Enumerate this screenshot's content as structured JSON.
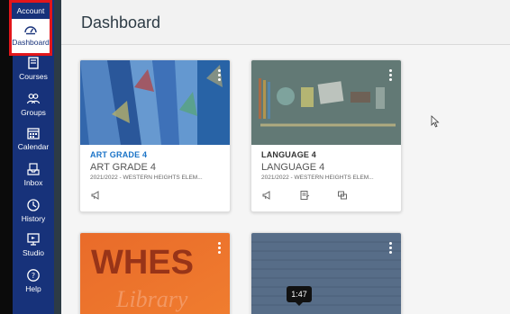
{
  "sidebar": {
    "account_label": "Account",
    "items": [
      {
        "label": "Dashboard",
        "icon": "dashboard-icon"
      },
      {
        "label": "Courses",
        "icon": "courses-icon"
      },
      {
        "label": "Groups",
        "icon": "groups-icon"
      },
      {
        "label": "Calendar",
        "icon": "calendar-icon"
      },
      {
        "label": "Inbox",
        "icon": "inbox-icon"
      },
      {
        "label": "History",
        "icon": "history-icon"
      },
      {
        "label": "Studio",
        "icon": "studio-icon"
      },
      {
        "label": "Help",
        "icon": "help-icon"
      }
    ],
    "highlight_color": "#e3161b",
    "nav_color": "#17327a"
  },
  "header": {
    "title": "Dashboard"
  },
  "cards": [
    {
      "link_label": "ART GRADE 4",
      "title": "ART GRADE 4",
      "term": "2021/2022 - WESTERN HEIGHTS ELEM...",
      "link_color": "#1a73c7",
      "icons": [
        "announcements-icon"
      ]
    },
    {
      "link_label": "LANGUAGE 4",
      "title": "LANGUAGE 4",
      "term": "2021/2022 - WESTERN HEIGHTS ELEM...",
      "link_color": "#333333",
      "icons": [
        "announcements-icon",
        "assignments-icon",
        "discussions-icon"
      ]
    },
    {
      "hero_text_1": "WHES",
      "hero_text_2": "Library"
    },
    {}
  ],
  "video": {
    "timestamp": "1:47"
  }
}
